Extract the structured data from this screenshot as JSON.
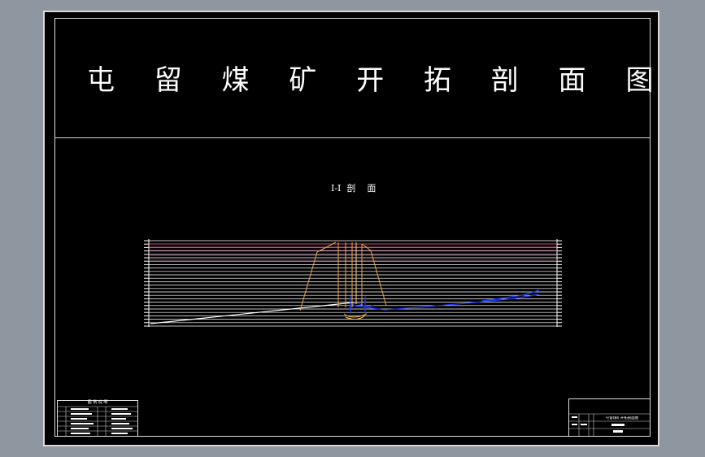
{
  "drawing": {
    "title": "屯 留 煤 矿 开 拓 剖 面 图",
    "section_label": "I-I  剖    面"
  },
  "legend": {
    "title": "图 例 说 明"
  },
  "title_block": {
    "drawing_name": "屯留煤矿开拓剖面图"
  },
  "colors": {
    "background": "#000000",
    "sheet_border": "#d8d8d8",
    "strata_lines": "#ffffff",
    "upper_strata": "#c0507a",
    "shafts": "#f2a93b",
    "roadways": "#1f3dff"
  }
}
